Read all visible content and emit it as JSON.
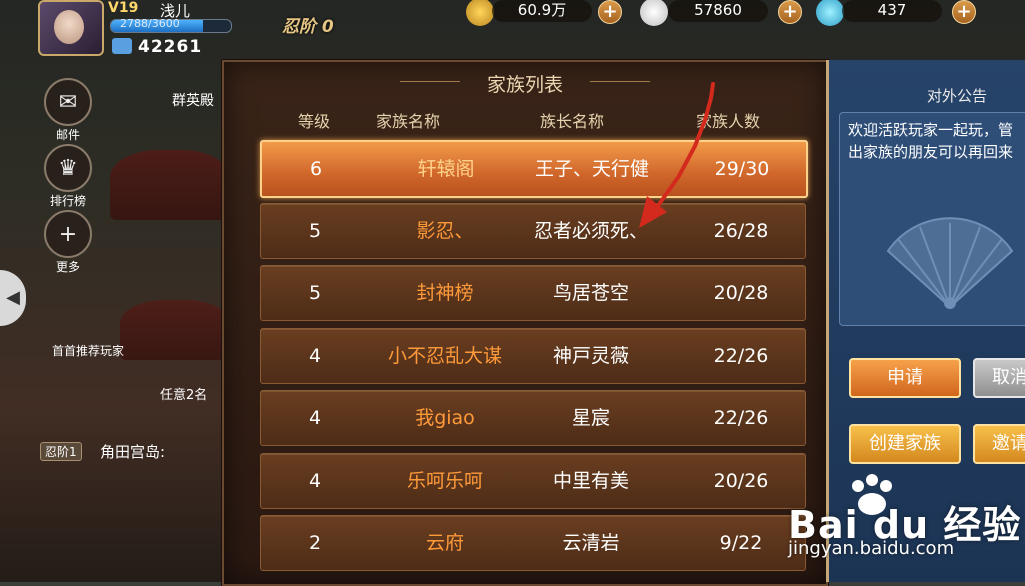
{
  "hud": {
    "vip": "V19",
    "player_name": "浅儿",
    "exp": "2788/3600",
    "exp_fraction": 0.77,
    "power": "42261",
    "ninja_rank": "忍阶 0",
    "coins": "60.9万",
    "food": "57860",
    "gems": "437"
  },
  "side_menu": {
    "mail": "邮件",
    "rank": "排行榜",
    "more": "更多",
    "heroes": "群英殿",
    "recommend": "首首推荐玩家",
    "task": "任意2名",
    "ninja_tag": "忍阶1",
    "location": "角田宫岛:"
  },
  "modal": {
    "title": "家族列表",
    "columns": [
      "等级",
      "家族名称",
      "族长名称",
      "家族人数"
    ],
    "rows": [
      {
        "level": "6",
        "clan": "轩辕阁",
        "leader": "王子、天行健",
        "members": "29/30",
        "selected": true
      },
      {
        "level": "5",
        "clan": "影忍、",
        "leader": "忍者必须死、",
        "members": "26/28",
        "selected": false
      },
      {
        "level": "5",
        "clan": "封神榜",
        "leader": "鸟居苍空",
        "members": "20/28",
        "selected": false
      },
      {
        "level": "4",
        "clan": "小不忍乱大谋",
        "leader": "神戸灵薇",
        "members": "22/26",
        "selected": false
      },
      {
        "level": "4",
        "clan": "我giao",
        "leader": "星宸",
        "members": "22/26",
        "selected": false
      },
      {
        "level": "4",
        "clan": "乐呵乐呵",
        "leader": "中里有美",
        "members": "20/26",
        "selected": false
      },
      {
        "level": "2",
        "clan": "云府",
        "leader": "云清岩",
        "members": "9/22",
        "selected": false
      }
    ]
  },
  "right_panel": {
    "notice_title": "对外公告",
    "notice_text_line1": "欢迎活跃玩家一起玩，管",
    "notice_text_line2": "出家族的朋友可以再回来",
    "apply": "申请",
    "cancel": "取消",
    "create": "创建家族",
    "invite": "邀请"
  },
  "watermark": {
    "logo": "Bai du 经验",
    "url": "jingyan.baidu.com"
  },
  "colors": {
    "accent_orange": "#d0662a",
    "clan_name": "#ff9a3a",
    "panel_blue": "#26436a",
    "arrow_red": "#d42a1e"
  }
}
